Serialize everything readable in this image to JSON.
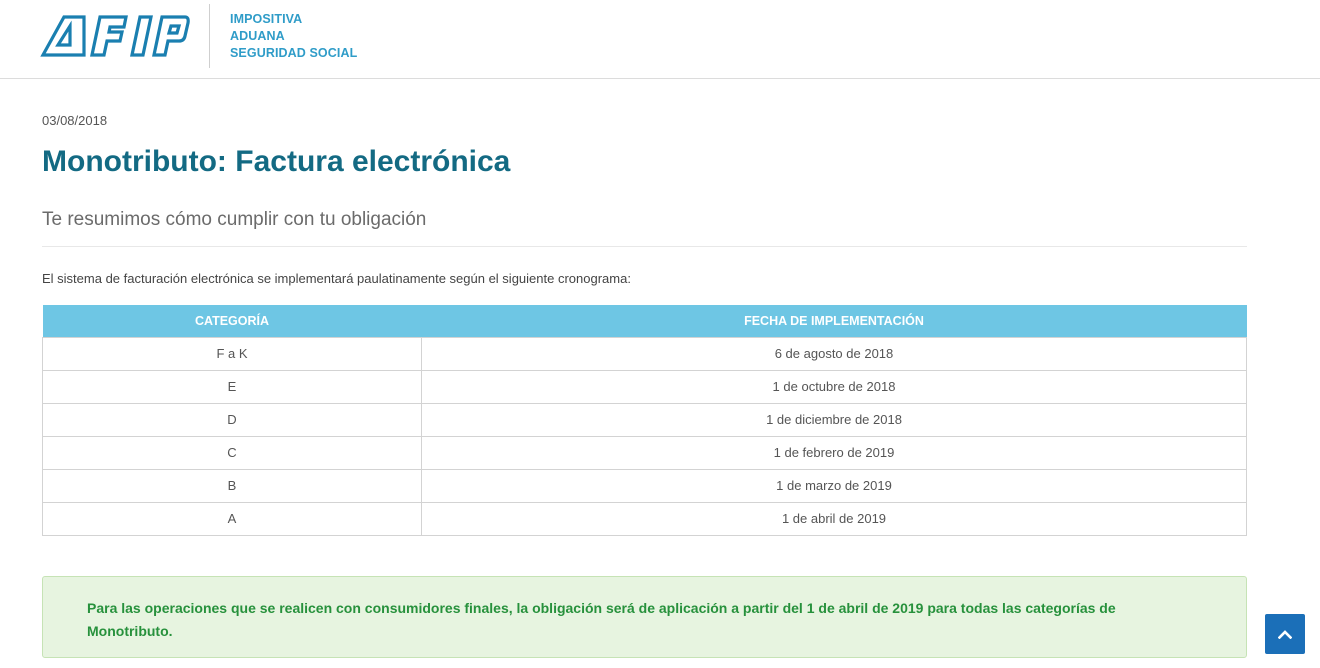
{
  "header": {
    "links": [
      "IMPOSITIVA",
      "ADUANA",
      "SEGURIDAD SOCIAL"
    ]
  },
  "article": {
    "date": "03/08/2018",
    "title": "Monotributo: Factura electrónica",
    "subtitle": "Te resumimos cómo cumplir con tu obligación",
    "intro": "El sistema de facturación electrónica se implementará paulatinamente según el siguiente cronograma:",
    "table": {
      "headers": [
        "CATEGORÍA",
        "FECHA DE IMPLEMENTACIÓN"
      ],
      "rows": [
        [
          "F a K",
          "6 de agosto de 2018"
        ],
        [
          "E",
          "1 de octubre de 2018"
        ],
        [
          "D",
          "1 de diciembre de 2018"
        ],
        [
          "C",
          "1 de febrero de 2019"
        ],
        [
          "B",
          "1 de marzo de 2019"
        ],
        [
          "A",
          "1 de abril de 2019"
        ]
      ]
    },
    "notice": "Para las operaciones que se realicen con consumidores finales, la obligación será de aplicación a partir del 1 de abril de 2019 para todas las categorías de Monotributo."
  },
  "icons": {
    "logo": "afip-logo",
    "scroll_top": "chevron-up-icon"
  },
  "colors": {
    "title": "#136a83",
    "header_links": "#2f9cc8",
    "table_header": "#6ec6e4",
    "notice_bg": "#e7f4e0",
    "notice_text": "#27913c",
    "scroll_button": "#1b6fb8"
  }
}
